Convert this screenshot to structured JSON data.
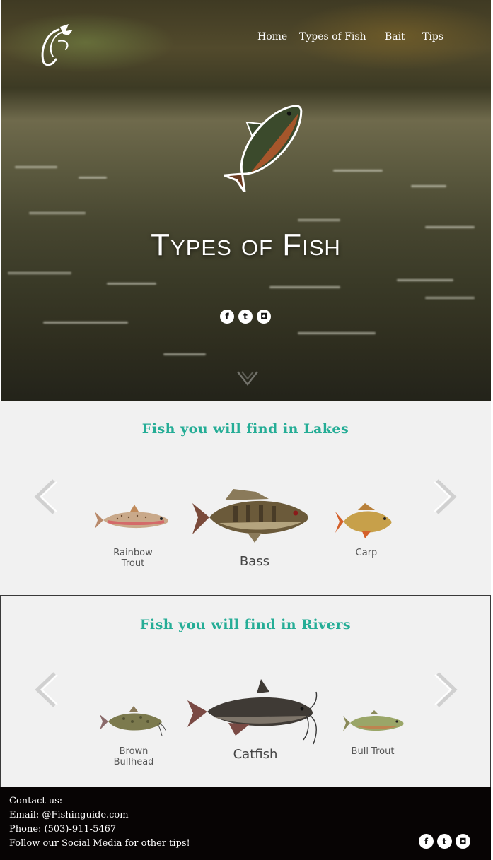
{
  "nav": {
    "items": [
      "Home",
      "Types of Fish",
      "Bait",
      "Tips"
    ]
  },
  "hero": {
    "title": "Types of Fish",
    "social": [
      {
        "icon": "facebook-icon",
        "glyph": "f"
      },
      {
        "icon": "twitter-icon",
        "glyph": "t"
      },
      {
        "icon": "instagram-icon",
        "glyph": "◘"
      }
    ]
  },
  "lakes": {
    "title": "Fish you will find in Lakes",
    "fish": [
      {
        "name": "Rainbow\nTrout"
      },
      {
        "name": "Bass"
      },
      {
        "name": "Carp"
      }
    ]
  },
  "rivers": {
    "title": "Fish you will find in Rivers",
    "fish": [
      {
        "name": "Brown\nBullhead"
      },
      {
        "name": "Catfish"
      },
      {
        "name": "Bull Trout"
      }
    ]
  },
  "footer": {
    "contact_heading": "Contact us:",
    "email": "Email: @Fishinguide.com",
    "phone": "Phone: (503)-911-5467",
    "follow": "Follow our Social Media for other tips!"
  },
  "colors": {
    "accent": "#25ad96",
    "section_bg": "#f1f1f1",
    "footer_bg": "#070404"
  }
}
